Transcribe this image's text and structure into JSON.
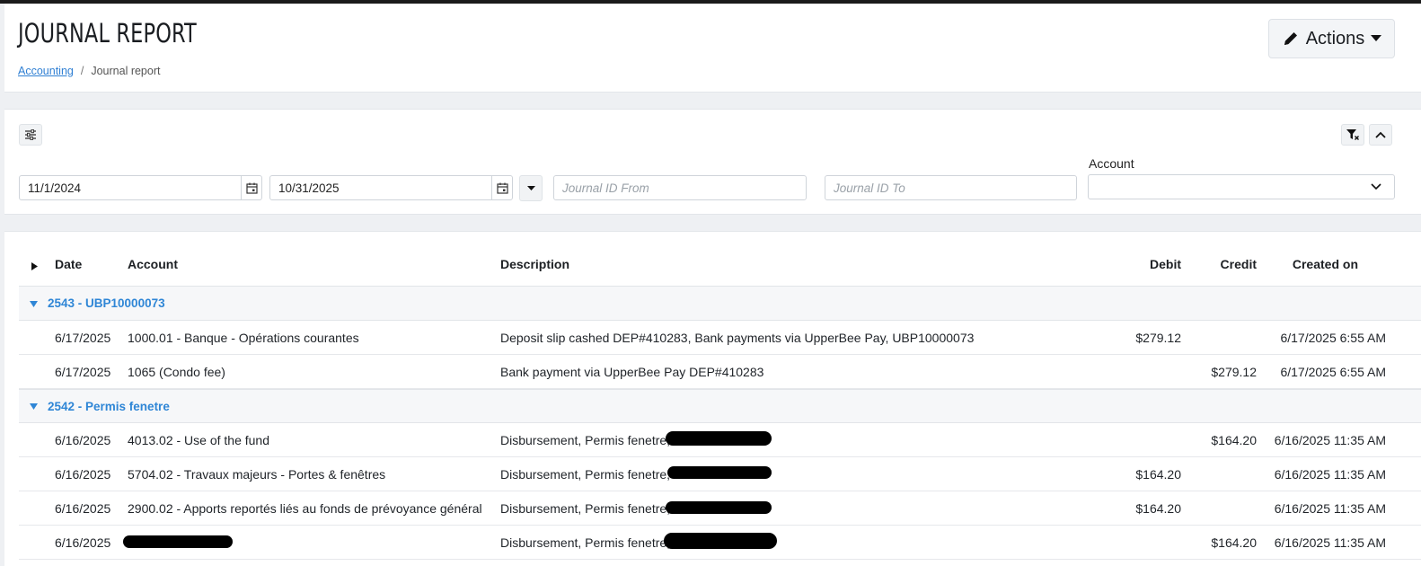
{
  "header": {
    "title": "JOURNAL REPORT",
    "breadcrumb": {
      "root": "Accounting",
      "separator": "/",
      "current": "Journal report"
    },
    "actions_label": "Actions"
  },
  "filters": {
    "date_from": "11/1/2024",
    "date_to": "10/31/2025",
    "journal_id_from_placeholder": "Journal ID From",
    "journal_id_to_placeholder": "Journal ID To",
    "account_label": "Account",
    "account_value": ""
  },
  "table": {
    "columns": {
      "date": "Date",
      "account": "Account",
      "description": "Description",
      "debit": "Debit",
      "credit": "Credit",
      "created_on": "Created on"
    },
    "groups": [
      {
        "label": "2543 - UBP10000073",
        "rows": [
          {
            "date": "6/17/2025",
            "account": "1000.01 - Banque - Opérations courantes",
            "description": "Deposit slip cashed DEP#410283, Bank payments via UpperBee Pay, UBP10000073",
            "debit": "$279.12",
            "credit": "",
            "created_on": "6/17/2025 6:55 AM"
          },
          {
            "date": "6/17/2025",
            "account": "1065 (Condo fee)",
            "description": "Bank payment via UpperBee Pay DEP#410283",
            "debit": "",
            "credit": "$279.12",
            "created_on": "6/17/2025 6:55 AM"
          }
        ]
      },
      {
        "label": "2542 - Permis fenetre",
        "rows": [
          {
            "date": "6/16/2025",
            "account": "4013.02 - Use of the fund",
            "description": "Disbursement, Permis fenetre,",
            "debit": "",
            "credit": "$164.20",
            "created_on": "6/16/2025 11:35 AM"
          },
          {
            "date": "6/16/2025",
            "account": "5704.02 - Travaux majeurs - Portes & fenêtres",
            "description": "Disbursement, Permis fenetre,",
            "debit": "$164.20",
            "credit": "",
            "created_on": "6/16/2025 11:35 AM"
          },
          {
            "date": "6/16/2025",
            "account": "2900.02 - Apports reportés liés au fonds de prévoyance général",
            "description": "Disbursement, Permis fenetre,",
            "debit": "$164.20",
            "credit": "",
            "created_on": "6/16/2025 11:35 AM"
          },
          {
            "date": "6/16/2025",
            "account": "",
            "description": "Disbursement, Permis fenetre,",
            "debit": "",
            "credit": "$164.20",
            "created_on": "6/16/2025 11:35 AM"
          }
        ]
      }
    ]
  }
}
